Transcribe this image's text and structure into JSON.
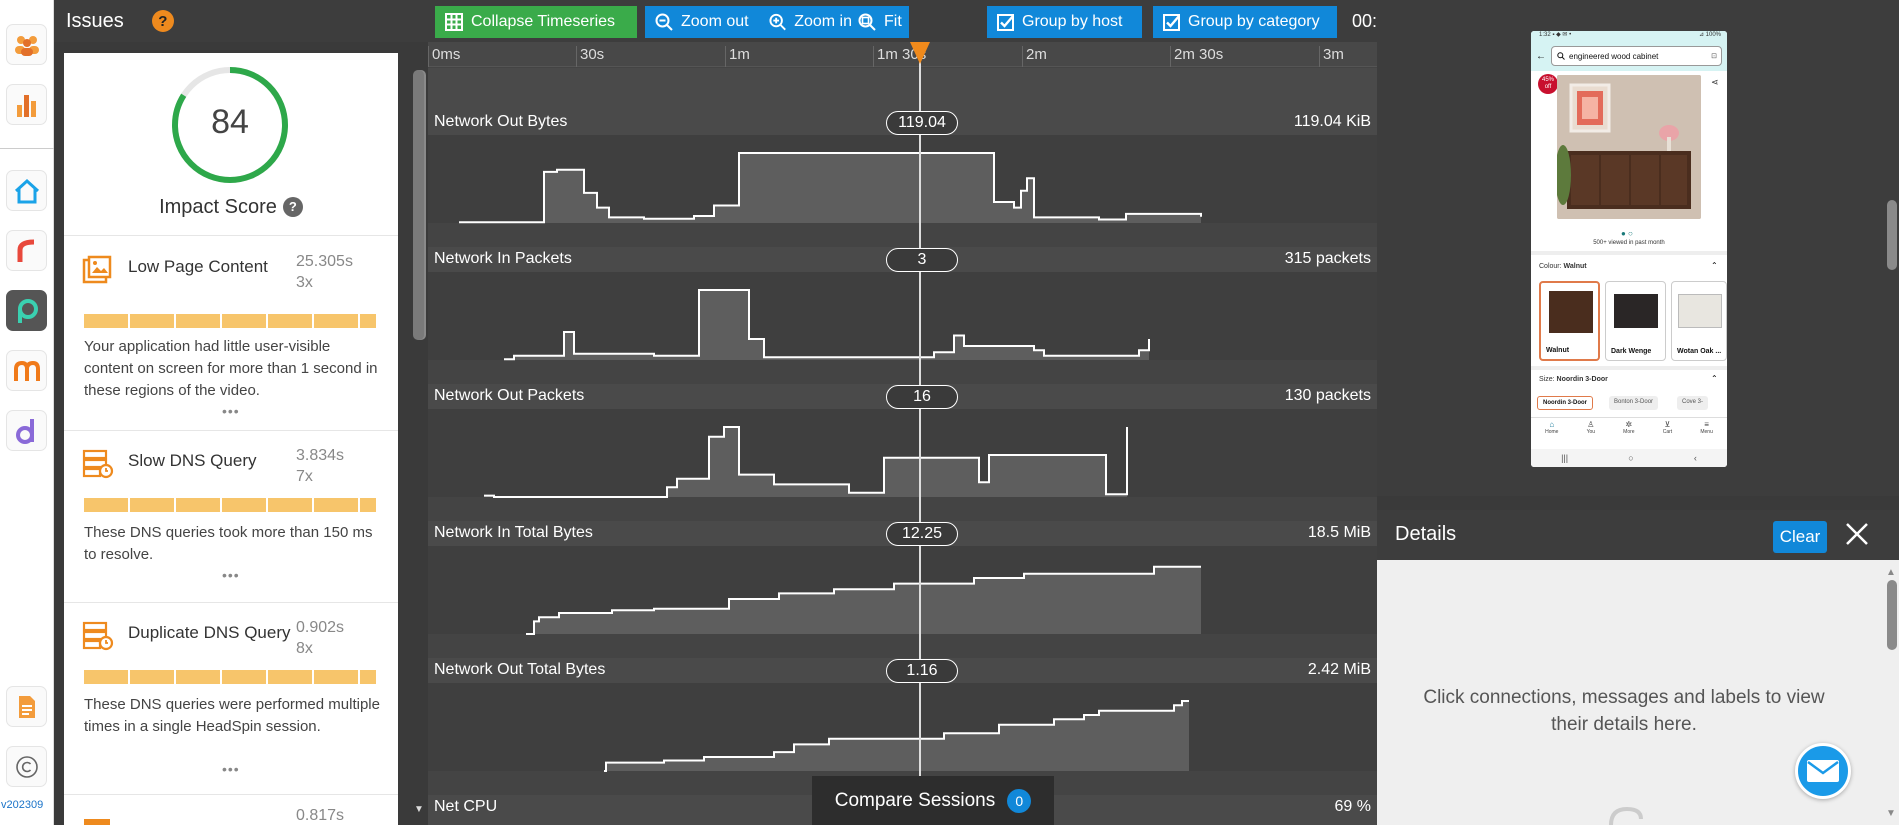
{
  "rail": {
    "items": [
      {
        "name": "users-icon"
      },
      {
        "name": "analytics-icon"
      },
      {
        "name": "home-icon"
      },
      {
        "name": "r-app-icon"
      },
      {
        "name": "p-app-icon"
      },
      {
        "name": "m-app-icon"
      },
      {
        "name": "d-app-icon"
      },
      {
        "name": "document-icon"
      },
      {
        "name": "copyright-icon"
      }
    ],
    "version": "v202309"
  },
  "issues": {
    "title": "Issues",
    "help": "?",
    "impact_score": 84,
    "impact_label": "Impact Score",
    "impact_help": "?",
    "items": [
      {
        "name": "Low Page Content",
        "time": "25.305s",
        "count": "3x",
        "desc": "Your application had little user-visible content on screen for more than 1 second in these regions of the video.",
        "more": "•••"
      },
      {
        "name": "Slow DNS Query",
        "time": "3.834s",
        "count": "7x",
        "desc": "These DNS queries took more than 150 ms to resolve.",
        "more": "•••"
      },
      {
        "name": "Duplicate DNS Query",
        "time": "0.902s",
        "count": "8x",
        "desc": "These DNS queries were performed multiple times in a single HeadSpin session.",
        "more": "•••"
      },
      {
        "name": "",
        "time": "0.817s",
        "count": "",
        "desc": "",
        "more": ""
      }
    ]
  },
  "toolbar": {
    "collapse": "Collapse Timeseries",
    "zoom_out": "Zoom out",
    "zoom_in": "Zoom in",
    "fit": "Fit",
    "group_host": "Group by host",
    "group_category": "Group by category",
    "clock": "00:"
  },
  "ruler": {
    "ticks": [
      "0ms",
      "30s",
      "1m",
      "1m 30s",
      "2m",
      "2m 30s",
      "3m"
    ]
  },
  "lanes": [
    {
      "title": "Network Out Bytes",
      "value": "119.04",
      "total": "119.04 KiB",
      "points": [
        [
          25,
          1
        ],
        [
          110,
          1
        ],
        [
          110,
          73
        ],
        [
          123,
          73
        ],
        [
          123,
          76
        ],
        [
          150,
          76
        ],
        [
          150,
          43
        ],
        [
          163,
          43
        ],
        [
          163,
          22
        ],
        [
          175,
          22
        ],
        [
          175,
          8
        ],
        [
          210,
          8
        ],
        [
          210,
          6
        ],
        [
          260,
          6
        ],
        [
          260,
          10
        ],
        [
          280,
          10
        ],
        [
          280,
          25
        ],
        [
          305,
          25
        ],
        [
          305,
          100
        ],
        [
          560,
          100
        ],
        [
          560,
          30
        ],
        [
          580,
          30
        ],
        [
          580,
          22
        ],
        [
          587,
          22
        ],
        [
          587,
          46
        ],
        [
          593,
          46
        ],
        [
          593,
          64
        ],
        [
          600,
          64
        ],
        [
          600,
          8
        ],
        [
          665,
          8
        ],
        [
          665,
          5
        ],
        [
          692,
          5
        ],
        [
          692,
          13
        ],
        [
          767,
          13
        ],
        [
          767,
          9
        ]
      ]
    },
    {
      "title": "Network In Packets",
      "value": "3",
      "total": "315 packets",
      "points": [
        [
          70,
          1
        ],
        [
          80,
          1
        ],
        [
          80,
          6
        ],
        [
          130,
          6
        ],
        [
          130,
          40
        ],
        [
          140,
          40
        ],
        [
          140,
          9
        ],
        [
          220,
          9
        ],
        [
          220,
          6
        ],
        [
          265,
          6
        ],
        [
          265,
          100
        ],
        [
          315,
          100
        ],
        [
          315,
          30
        ],
        [
          330,
          30
        ],
        [
          330,
          4
        ],
        [
          500,
          4
        ],
        [
          500,
          11
        ],
        [
          520,
          11
        ],
        [
          520,
          35
        ],
        [
          530,
          35
        ],
        [
          530,
          20
        ],
        [
          600,
          20
        ],
        [
          600,
          14
        ],
        [
          610,
          14
        ],
        [
          610,
          6
        ],
        [
          705,
          6
        ],
        [
          705,
          14
        ],
        [
          715,
          14
        ],
        [
          715,
          30
        ]
      ]
    },
    {
      "title": "Network Out Packets",
      "value": "16",
      "total": "130 packets",
      "points": [
        [
          50,
          2
        ],
        [
          60,
          2
        ],
        [
          60,
          0
        ],
        [
          233,
          0
        ],
        [
          233,
          14
        ],
        [
          243,
          14
        ],
        [
          243,
          26
        ],
        [
          275,
          26
        ],
        [
          275,
          86
        ],
        [
          290,
          86
        ],
        [
          290,
          100
        ],
        [
          305,
          100
        ],
        [
          305,
          32
        ],
        [
          340,
          32
        ],
        [
          340,
          18
        ],
        [
          415,
          18
        ],
        [
          415,
          6
        ],
        [
          450,
          6
        ],
        [
          450,
          56
        ],
        [
          545,
          56
        ],
        [
          545,
          21
        ],
        [
          555,
          21
        ],
        [
          555,
          60
        ],
        [
          672,
          60
        ],
        [
          672,
          4
        ],
        [
          693,
          4
        ],
        [
          693,
          100
        ]
      ]
    },
    {
      "title": "Network In Total Bytes",
      "value": "12.25",
      "total": "18.5 MiB",
      "points": [
        [
          92,
          0
        ],
        [
          100,
          0
        ],
        [
          100,
          18
        ],
        [
          105,
          18
        ],
        [
          105,
          24
        ],
        [
          125,
          24
        ],
        [
          125,
          30
        ],
        [
          178,
          30
        ],
        [
          178,
          34
        ],
        [
          220,
          34
        ],
        [
          220,
          36
        ],
        [
          295,
          36
        ],
        [
          295,
          50
        ],
        [
          345,
          50
        ],
        [
          345,
          58
        ],
        [
          400,
          58
        ],
        [
          400,
          64
        ],
        [
          460,
          64
        ],
        [
          460,
          72
        ],
        [
          540,
          72
        ],
        [
          540,
          80
        ],
        [
          590,
          80
        ],
        [
          590,
          86
        ],
        [
          720,
          86
        ],
        [
          720,
          96
        ],
        [
          767,
          96
        ]
      ]
    },
    {
      "title": "Network Out Total Bytes",
      "value": "1.16",
      "total": "2.42 MiB",
      "points": [
        [
          170,
          0
        ],
        [
          172,
          0
        ],
        [
          172,
          12
        ],
        [
          230,
          12
        ],
        [
          230,
          15
        ],
        [
          270,
          15
        ],
        [
          270,
          20
        ],
        [
          340,
          20
        ],
        [
          340,
          27
        ],
        [
          360,
          27
        ],
        [
          360,
          38
        ],
        [
          395,
          38
        ],
        [
          395,
          46
        ],
        [
          510,
          46
        ],
        [
          510,
          54
        ],
        [
          565,
          54
        ],
        [
          565,
          66
        ],
        [
          620,
          66
        ],
        [
          620,
          74
        ],
        [
          650,
          74
        ],
        [
          650,
          80
        ],
        [
          665,
          80
        ],
        [
          665,
          86
        ],
        [
          740,
          86
        ],
        [
          740,
          94
        ],
        [
          748,
          94
        ],
        [
          748,
          100
        ],
        [
          755,
          100
        ]
      ]
    },
    {
      "title": "Net CPU",
      "value": "",
      "total": "69 %",
      "points": []
    }
  ],
  "compare": {
    "label": "Compare Sessions",
    "count": "0"
  },
  "phone": {
    "status": "1:32 ▪ ◆ ✉ •",
    "battery": "⊿ 100%",
    "search": "engineered wood cabinet",
    "badge": "45% off",
    "viewed": "500+ viewed in past month",
    "colour_label": "Colour:",
    "colour_value": "Walnut",
    "swatches": [
      "Walnut",
      "Dark Wenge",
      "Wotan Oak ..."
    ],
    "size_label": "Size:",
    "size_value": "Noordin 3-Door",
    "sizes": [
      "Noordin 3-Door",
      "Bonton 3-Door",
      "Cove 3-"
    ],
    "nav": [
      "Home",
      "You",
      "More",
      "Cart",
      "Menu"
    ],
    "sysnav": [
      "|||",
      "○",
      "‹"
    ]
  },
  "details": {
    "title": "Details",
    "clear": "Clear",
    "hint": "Click connections, messages and labels to view their details here."
  },
  "colors": {
    "accent": "#1188d9",
    "green": "#3aab4a",
    "orange": "#ee8a1e",
    "issue_bar": "#f7c56b"
  }
}
